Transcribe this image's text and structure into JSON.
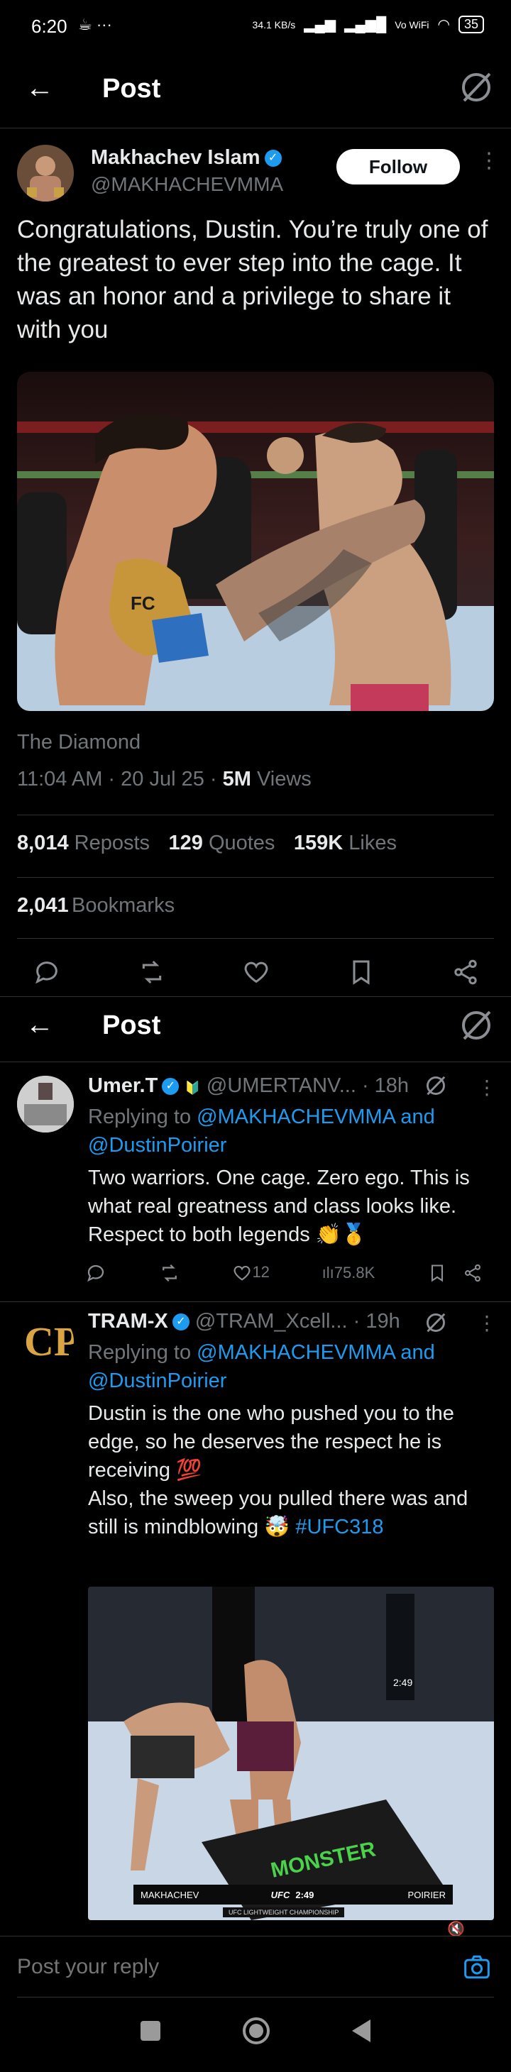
{
  "status_bar": {
    "time": "6:20",
    "network_speed": "34.1 KB/s",
    "wifi_label": "Vo WiFi",
    "battery": "35"
  },
  "header": {
    "title": "Post"
  },
  "post": {
    "author_name": "Makhachev Islam",
    "author_handle": "@MAKHACHEVMMA",
    "follow_label": "Follow",
    "text": "Congratulations, Dustin. You’re truly one of the greatest to ever step into the cage. It was an honor and a privilege to share it with you",
    "location": "The Diamond",
    "timestamp": "11:04 AM · 20 Jul 25 · ",
    "views_count": "5M",
    "views_label": " Views",
    "reposts_count": "8,014",
    "reposts_label": "Reposts",
    "quotes_count": "129",
    "quotes_label": "Quotes",
    "likes_count": "159K",
    "likes_label": "Likes",
    "bookmarks_count": "2,041",
    "bookmarks_label": "Bookmarks"
  },
  "sticky_header": {
    "title": "Post"
  },
  "replies": [
    {
      "name": "Umer.T",
      "handle": "@UMERTANV...",
      "time": "· 18h",
      "replying_prefix": "Replying to ",
      "replying_to_1": "@MAKHACHEVMMA",
      "replying_and": " and",
      "replying_to_2": "@DustinPoirier",
      "text": "Two warriors. One cage. Zero ego. This is what real greatness and class looks like. Respect to both legends 👏🥇",
      "likes": "12",
      "views": "75.8K"
    },
    {
      "name": "TRAM-X",
      "handle": "@TRAM_Xcell...",
      "time": "· 19h",
      "replying_prefix": "Replying to ",
      "replying_to_1": "@MAKHACHEVMMA",
      "replying_and": " and",
      "replying_to_2": "@DustinPoirier",
      "text_line1": "Dustin is the one who pushed you to the edge, so he deserves the respect he is receiving 💯",
      "text_line2": "Also, the sweep you pulled there was and still is mindblowing 🤯 ",
      "hashtag": "#UFC318",
      "video_scorebug": {
        "fighter1": "MAKHACHEV",
        "fighter2": "POIRIER",
        "clock": "2:49",
        "org": "UFC",
        "round_clock": "2:49",
        "sub": "UFC LIGHTWEIGHT CHAMPIONSHIP"
      }
    }
  ],
  "composer": {
    "placeholder": "Post your reply"
  },
  "colors": {
    "accent": "#1d9bf0",
    "background": "#000000",
    "divider": "#2f3336",
    "muted": "#71767b"
  }
}
